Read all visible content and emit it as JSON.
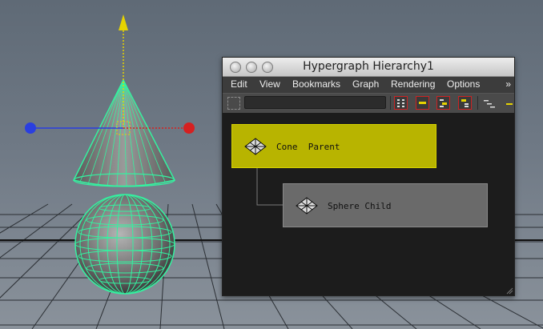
{
  "window": {
    "title": "Hypergraph Hierarchy1"
  },
  "menu": {
    "items": [
      "Edit",
      "View",
      "Bookmarks",
      "Graph",
      "Rendering",
      "Options"
    ],
    "overflow": "»"
  },
  "toolbar": {
    "filter_value": ""
  },
  "graph": {
    "nodes": [
      {
        "label": "Cone  Parent",
        "state": "selected",
        "color": "#b8b400"
      },
      {
        "label": "Sphere Child",
        "state": "normal",
        "color": "#6a6a6a"
      }
    ]
  },
  "viewport": {
    "objects": [
      "cone",
      "sphere"
    ],
    "wireframe_color": "#34f2a0",
    "manipulator": [
      "move-x-red",
      "move-y-yellow",
      "move-z-blue"
    ]
  }
}
